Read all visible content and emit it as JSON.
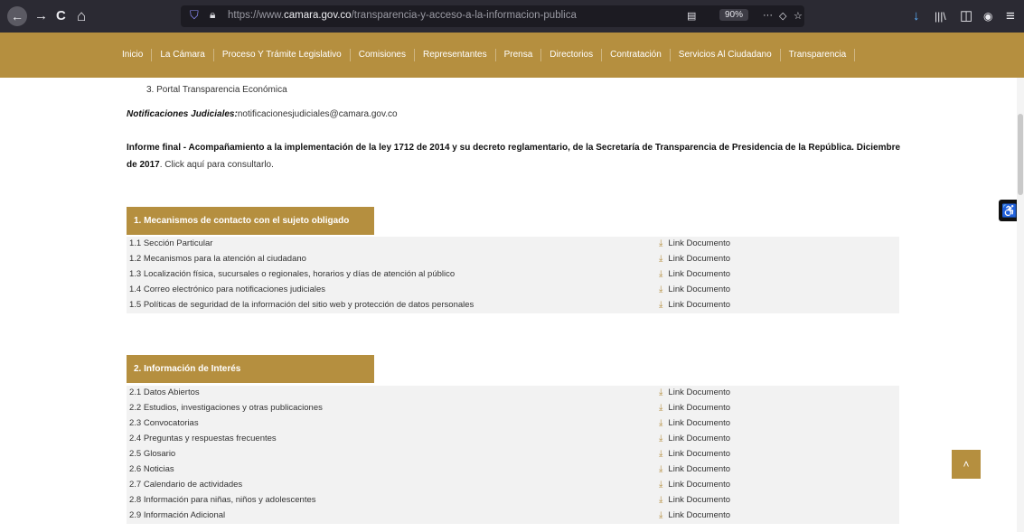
{
  "browser": {
    "back_icon": "←",
    "forward_icon": "→",
    "reload_icon": "C",
    "home_icon": "⌂",
    "url_prefix": "https://www.",
    "url_domain": "camara.gov.co",
    "url_path": "/transparencia-y-acceso-a-la-informacion-publica",
    "zoom": "90%",
    "more_icon": "···",
    "pocket_icon": "◇",
    "star_icon": "☆",
    "download_icon": "↓",
    "library_icon": "|||\\",
    "sidebar_icon": "◫",
    "account_icon": "◉",
    "menu_icon": "≡"
  },
  "nav": {
    "items": [
      "Inicio",
      "La Cámara",
      "Proceso Y Trámite Legislativo",
      "Comisiones",
      "Representantes",
      "Prensa",
      "Directorios",
      "Contratación",
      "Servicios Al Ciudadano",
      "Transparencia"
    ]
  },
  "content": {
    "prev_item": "3.  Portal Transparencia Económica",
    "notif_label": "Notificaciones Judiciales:",
    "notif_value": "notificacionesjudiciales@camara.gov.co",
    "informe_bold": "Informe final - Acompañamiento a la implementación de la ley 1712 de 2014 y su decreto reglamentario, de la Secretaría de Transparencia de Presidencia de la República. Diciembre de 2017",
    "informe_rest": ". Click aquí para consultarlo."
  },
  "sections": [
    {
      "title": "1. Mecanismos de contacto con el sujeto obligado",
      "rows": [
        {
          "label": "1.1 Sección Particular",
          "link": "Link Documento"
        },
        {
          "label": "1.2 Mecanismos para la atención al ciudadano",
          "link": "Link Documento"
        },
        {
          "label": "1.3 Localización física, sucursales o regionales, horarios y días de atención al público",
          "link": "Link Documento"
        },
        {
          "label": "1.4 Correo electrónico para notificaciones judiciales",
          "link": "Link Documento"
        },
        {
          "label": "1.5 Políticas de seguridad de la información del sitio web y protección de datos personales",
          "link": "Link Documento"
        }
      ]
    },
    {
      "title": "2. Información de Interés",
      "rows": [
        {
          "label": "2.1 Datos Abiertos",
          "link": "Link Documento"
        },
        {
          "label": "2.2 Estudios, investigaciones y otras publicaciones",
          "link": "Link Documento"
        },
        {
          "label": "2.3 Convocatorias",
          "link": "Link Documento"
        },
        {
          "label": "2.4 Preguntas y respuestas frecuentes",
          "link": "Link Documento"
        },
        {
          "label": "2.5 Glosario",
          "link": "Link Documento"
        },
        {
          "label": "2.6 Noticias",
          "link": "Link Documento"
        },
        {
          "label": "2.7 Calendario de actividades",
          "link": "Link Documento"
        },
        {
          "label": "2.8 Información para niñas, niños y adolescentes",
          "link": "Link Documento"
        },
        {
          "label": "2.9 Información Adicional",
          "link": "Link Documento"
        }
      ]
    }
  ],
  "widgets": {
    "accessibility_icon": "♿",
    "scroll_top_icon": "˄"
  },
  "colors": {
    "gold": "#b58f3f",
    "chrome": "#2b2a33"
  }
}
